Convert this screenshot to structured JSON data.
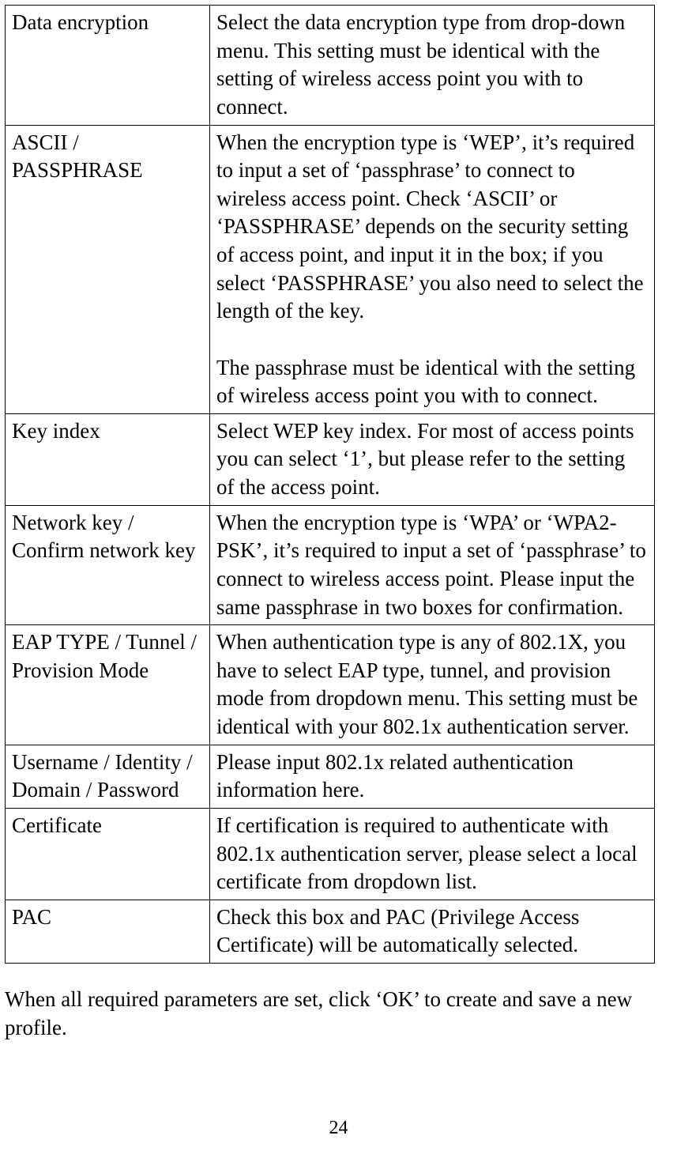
{
  "rows": [
    {
      "left": "Data encryption",
      "right": "Select the data encryption type from drop-down menu. This setting must be identical with the setting of wireless access point you with to connect."
    },
    {
      "left": "ASCII / PASSPHRASE",
      "right": "When the encryption type is ‘WEP’, it’s required to input a set of ‘passphrase’ to connect to wireless access point. Check ‘ASCII’ or ‘PASSPHRASE’ depends on the security setting of access point, and input it in the box; if you select ‘PASSPHRASE’ you also need to select the length of the key.\n\nThe passphrase must be identical with the setting of wireless access point you with to connect."
    },
    {
      "left": "Key index",
      "right": "Select WEP key index. For most of access points you can select ‘1’, but please refer to the setting of the access point."
    },
    {
      "left": "Network key / Confirm network key",
      "right": "When the encryption type is ‘WPA’ or ‘WPA2-PSK’, it’s required to input a set of ‘passphrase’ to connect to wireless access point. Please input the same passphrase in two boxes for confirmation."
    },
    {
      "left": "EAP TYPE / Tunnel /\nProvision Mode",
      "right": "When authentication type is any of 802.1X, you have to select EAP type, tunnel, and provision mode from dropdown menu. This setting must be identical with your 802.1x authentication server."
    },
    {
      "left": "Username / Identity / Domain / Password",
      "right": "Please input 802.1x related authentication information here."
    },
    {
      "left": "Certificate",
      "right": "If certification is required to authenticate with 802.1x authentication server, please select a local certificate from dropdown list."
    },
    {
      "left": "PAC",
      "right": "Check this box and PAC (Privilege Access Certificate) will be automatically selected."
    }
  ],
  "footer": "When all required parameters are set, click ‘OK’ to create and save a new profile.",
  "page_number": "24"
}
